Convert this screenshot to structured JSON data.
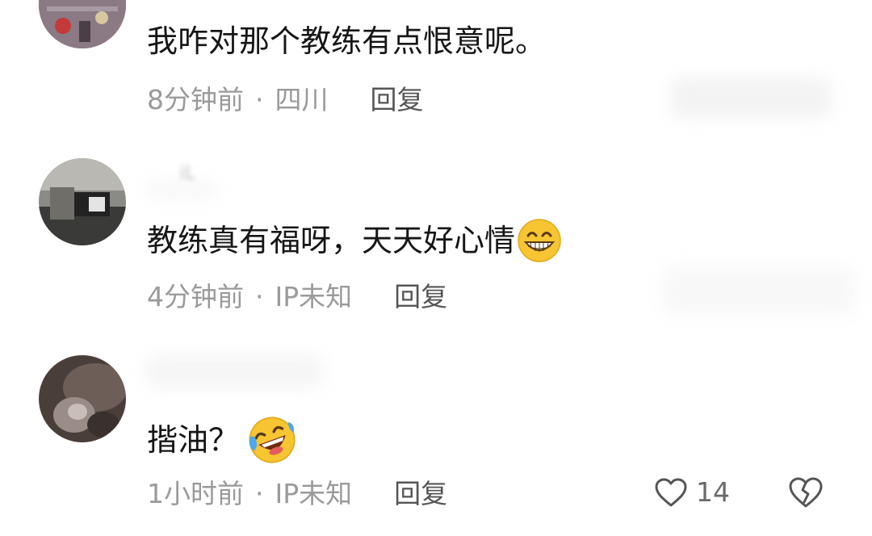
{
  "comments": [
    {
      "text": "我咋对那个教练有点恨意呢。",
      "time": "8分钟前",
      "location": "四川",
      "reply_label": "回复",
      "avatar_icon": "avatar-photo-icon"
    },
    {
      "username": "iL",
      "text": "教练真有福呀，天天好心情",
      "emoji_icon": "grinning-face-emoji",
      "time": "4分钟前",
      "location": "IP未知",
      "reply_label": "回复",
      "avatar_icon": "avatar-photo-icon"
    },
    {
      "text": "揩油？",
      "emoji_icon": "rolling-laughing-emoji",
      "time": "1小时前",
      "location": "IP未知",
      "reply_label": "回复",
      "like_count": "14",
      "avatar_icon": "avatar-photo-icon"
    }
  ],
  "meta_separator": "·",
  "icons": {
    "like": "heart-outline-icon",
    "dislike": "broken-heart-icon"
  },
  "colors": {
    "text": "#161616",
    "meta": "#9a9a9a",
    "reply": "#555555",
    "emoji_yellow": "#f7c531"
  }
}
